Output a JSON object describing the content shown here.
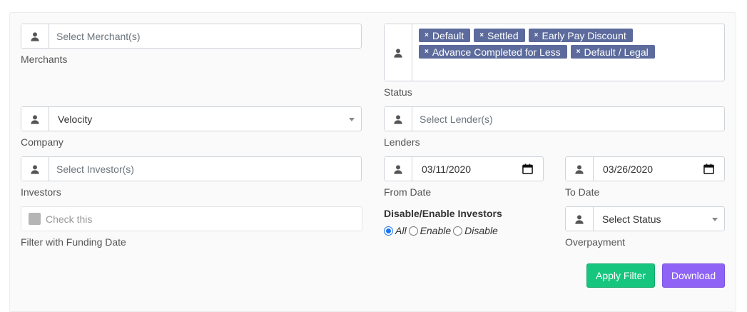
{
  "merchants": {
    "placeholder": "Select Merchant(s)",
    "label": "Merchants"
  },
  "status": {
    "tags": [
      "Default",
      "Settled",
      "Early Pay Discount",
      "Advance Completed for Less",
      "Default / Legal"
    ],
    "remove_glyph": "×",
    "label": "Status"
  },
  "company": {
    "value": "Velocity",
    "label": "Company"
  },
  "lenders": {
    "placeholder": "Select Lender(s)",
    "label": "Lenders"
  },
  "investors": {
    "placeholder": "Select Investor(s)",
    "label": "Investors"
  },
  "from_date": {
    "value": "03/11/2020",
    "label": "From Date"
  },
  "to_date": {
    "value": "03/26/2020",
    "label": "To Date"
  },
  "funding_date": {
    "checkbox_text": "Check this",
    "label": "Filter with Funding Date"
  },
  "disable_enable": {
    "heading": "Disable/Enable Investors",
    "options": [
      "All",
      "Enable",
      "Disable"
    ],
    "selected": "All"
  },
  "overpayment": {
    "value": "Select Status",
    "label": "Overpayment"
  },
  "buttons": {
    "apply": "Apply Filter",
    "download": "Download"
  },
  "colors": {
    "tag_bg": "#5c6b9c",
    "apply_bg": "#17c67e",
    "download_bg": "#8e63f5",
    "radio_selected": "#1a73e8"
  },
  "icons": {
    "input_addon": "user-icon",
    "date_picker": "calendar-icon",
    "select_caret": "caret-down-icon",
    "tag_remove": "close-icon"
  }
}
